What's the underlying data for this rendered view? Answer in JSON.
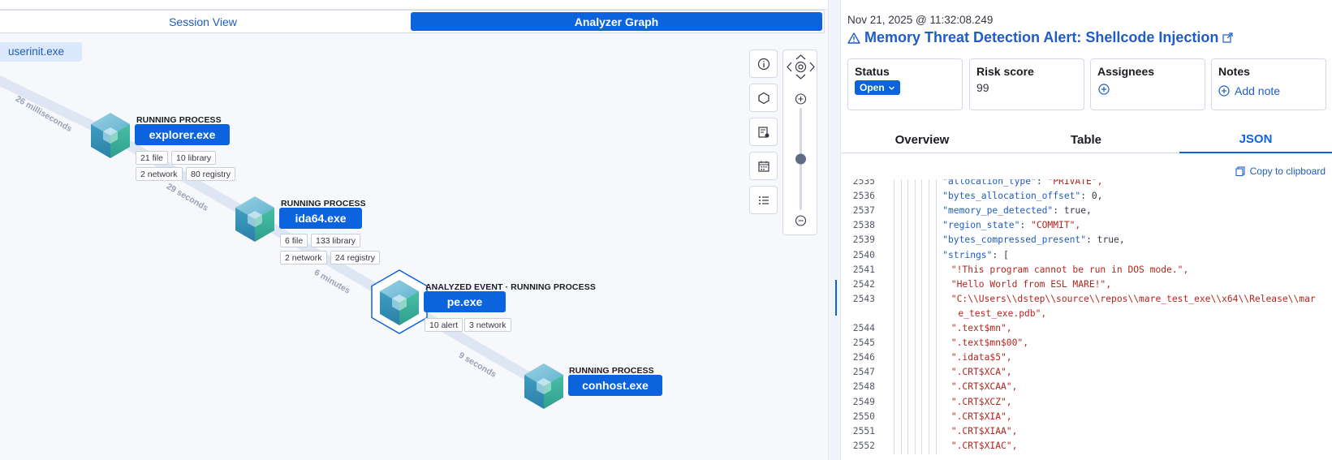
{
  "toggle": {
    "session_view": "Session View",
    "analyzer_graph": "Analyzer Graph"
  },
  "graph": {
    "root_node": "userinit.exe",
    "edges": [
      {
        "label": "26 milliseconds"
      },
      {
        "label": "29 seconds"
      },
      {
        "label": "6 minutes"
      },
      {
        "label": "9 seconds"
      }
    ],
    "nodes": [
      {
        "type": "RUNNING PROCESS",
        "name": "explorer.exe",
        "pills": [
          "21 file",
          "10 library",
          "2 network",
          "80 registry"
        ]
      },
      {
        "type": "RUNNING PROCESS",
        "name": "ida64.exe",
        "pills": [
          "6 file",
          "133 library",
          "2 network",
          "24 registry"
        ]
      },
      {
        "type": "ANALYZED EVENT · RUNNING PROCESS",
        "name": "pe.exe",
        "pills": [
          "10 alert",
          "3 network"
        ]
      },
      {
        "type": "RUNNING PROCESS",
        "name": "conhost.exe",
        "pills": []
      }
    ],
    "zoom_level": 0.5,
    "colors": {
      "accent": "#0b64dd",
      "edge": "#dfe6f3"
    }
  },
  "alert": {
    "timestamp": "Nov 21, 2025 @ 11:32:08.249",
    "title": "Memory Threat Detection Alert: Shellcode Injection",
    "status_label": "Status",
    "status_value": "Open",
    "risk_label": "Risk score",
    "risk_value": "99",
    "assignees_label": "Assignees",
    "notes_label": "Notes",
    "add_note": "Add note"
  },
  "tabs": [
    "Overview",
    "Table",
    "JSON"
  ],
  "active_tab": "JSON",
  "copy_label": "Copy to clipboard",
  "json_lines": [
    {
      "n": "2535",
      "indent": 7,
      "key": "\"allocation_type\"",
      "value": "\"PRIVATE\",",
      "vtype": "s"
    },
    {
      "n": "2536",
      "indent": 7,
      "key": "\"bytes_allocation_offset\"",
      "value": "0,",
      "vtype": "p"
    },
    {
      "n": "2537",
      "indent": 7,
      "key": "\"memory_pe_detected\"",
      "value": "true,",
      "vtype": "p"
    },
    {
      "n": "2538",
      "indent": 7,
      "key": "\"region_state\"",
      "value": "\"COMMIT\",",
      "vtype": "s"
    },
    {
      "n": "2539",
      "indent": 7,
      "key": "\"bytes_compressed_present\"",
      "value": "true,",
      "vtype": "p"
    },
    {
      "n": "2540",
      "indent": 7,
      "key": "\"strings\"",
      "value": "[",
      "vtype": "p"
    },
    {
      "n": "2541",
      "indent": 8,
      "key": "",
      "value": "\"!This program cannot be run in DOS mode.\",",
      "vtype": "s"
    },
    {
      "n": "2542",
      "indent": 8,
      "key": "",
      "value": "\"Hello World from ESL MARE!\",",
      "vtype": "s"
    },
    {
      "n": "2543",
      "indent": 8,
      "key": "",
      "value": "\"C:\\\\Users\\\\dstep\\\\source\\\\repos\\\\mare_test_exe\\\\x64\\\\Release\\\\mar",
      "vtype": "s"
    },
    {
      "n": "",
      "indent": 9,
      "key": "",
      "value": "e_test_exe.pdb\",",
      "vtype": "s"
    },
    {
      "n": "2544",
      "indent": 8,
      "key": "",
      "value": "\".text$mn\",",
      "vtype": "s"
    },
    {
      "n": "2545",
      "indent": 8,
      "key": "",
      "value": "\".text$mn$00\",",
      "vtype": "s"
    },
    {
      "n": "2546",
      "indent": 8,
      "key": "",
      "value": "\".idata$5\",",
      "vtype": "s"
    },
    {
      "n": "2547",
      "indent": 8,
      "key": "",
      "value": "\".CRT$XCA\",",
      "vtype": "s"
    },
    {
      "n": "2548",
      "indent": 8,
      "key": "",
      "value": "\".CRT$XCAA\",",
      "vtype": "s"
    },
    {
      "n": "2549",
      "indent": 8,
      "key": "",
      "value": "\".CRT$XCZ\",",
      "vtype": "s"
    },
    {
      "n": "2550",
      "indent": 8,
      "key": "",
      "value": "\".CRT$XIA\",",
      "vtype": "s"
    },
    {
      "n": "2551",
      "indent": 8,
      "key": "",
      "value": "\".CRT$XIAA\",",
      "vtype": "s"
    },
    {
      "n": "2552",
      "indent": 8,
      "key": "",
      "value": "\".CRT$XIAC\",",
      "vtype": "s"
    }
  ]
}
